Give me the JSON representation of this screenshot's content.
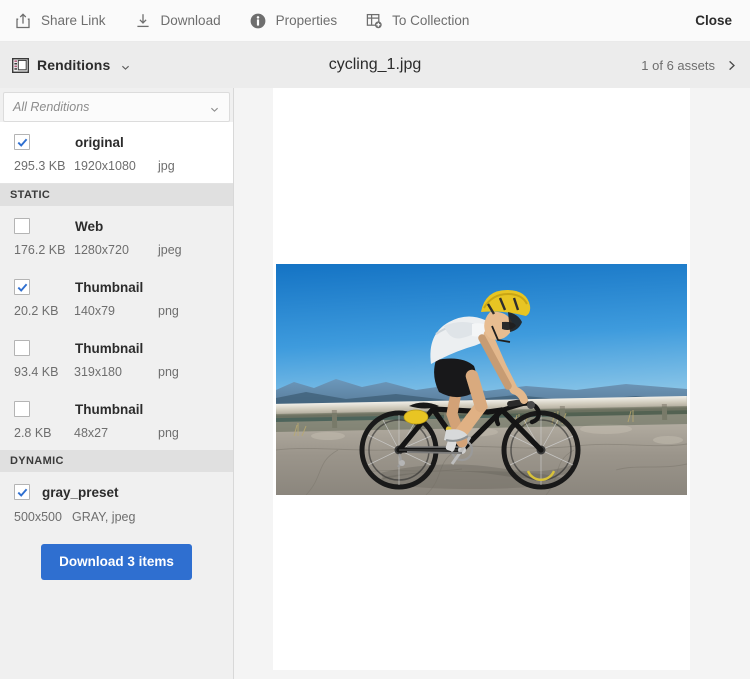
{
  "toolbar": {
    "items": [
      {
        "label": "Share Link",
        "icon": "share-link-icon"
      },
      {
        "label": "Download",
        "icon": "download-icon"
      },
      {
        "label": "Properties",
        "icon": "info-icon"
      },
      {
        "label": "To Collection",
        "icon": "add-to-collection-icon"
      }
    ],
    "close_label": "Close"
  },
  "subheader": {
    "panel_label": "Renditions",
    "panel_icon": "renditions-panel-icon",
    "caret_icon": "chevron-down-icon",
    "asset_title": "cycling_1.jpg",
    "asset_count": "1 of 6 assets",
    "next_icon": "chevron-right-icon"
  },
  "sidebar": {
    "filter": {
      "value": "All Renditions",
      "placeholder": "All Renditions",
      "caret_icon": "chevron-down-icon"
    },
    "renditions": [
      {
        "name": "original",
        "checked": true,
        "size": "295.3 KB",
        "dimensions": "1920x1080",
        "format": "jpg"
      }
    ],
    "sections": [
      {
        "title": "STATIC",
        "items": [
          {
            "name": "Web",
            "checked": false,
            "size": "176.2 KB",
            "dimensions": "1280x720",
            "format": "jpeg"
          },
          {
            "name": "Thumbnail",
            "checked": true,
            "size": "20.2 KB",
            "dimensions": "140x79",
            "format": "png"
          },
          {
            "name": "Thumbnail",
            "checked": false,
            "size": "93.4 KB",
            "dimensions": "319x180",
            "format": "png"
          },
          {
            "name": "Thumbnail",
            "checked": false,
            "size": "2.8 KB",
            "dimensions": "48x27",
            "format": "png"
          }
        ]
      },
      {
        "title": "DYNAMIC",
        "items": [
          {
            "name": "gray_preset",
            "checked": true,
            "dimensions": "500x500",
            "format": "GRAY, jpeg"
          }
        ]
      }
    ],
    "download_button": "Download 3 items"
  },
  "preview": {
    "image_alt": "cyclist riding a road bike on a mountain road"
  },
  "colors": {
    "accent_blue": "#2f6fd0",
    "checkbox_check": "#2f6fd0",
    "toolbar_bg": "#fafafa",
    "subheader_bg": "#ececec",
    "sidebar_bg": "#f0f0f0",
    "section_head_bg": "#e0e0e0",
    "canvas_bg": "#f4f4f4"
  }
}
